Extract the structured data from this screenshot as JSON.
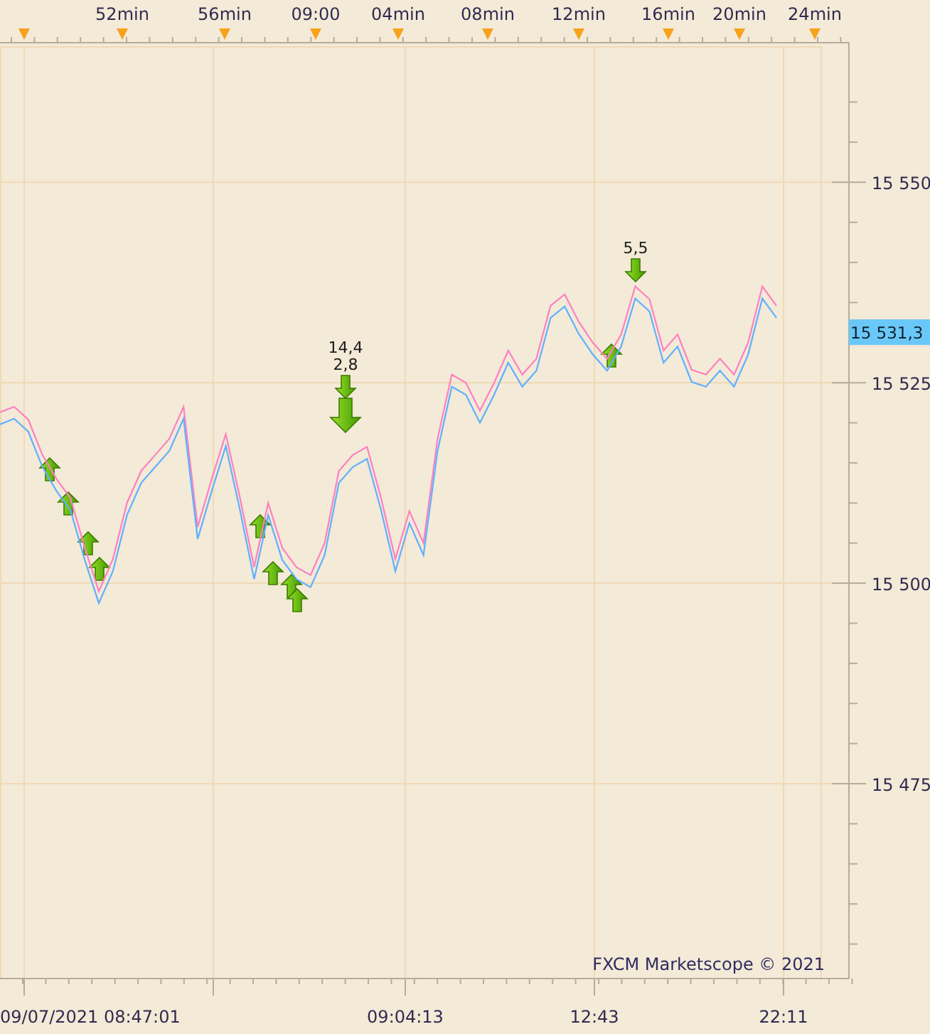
{
  "chart": {
    "footer": "FXCM Marketscope © 2021",
    "top_axis": [
      {
        "label": "52min"
      },
      {
        "label": "56min"
      },
      {
        "label": "09:00"
      },
      {
        "label": "04min"
      },
      {
        "label": "08min"
      },
      {
        "label": "12min"
      },
      {
        "label": "16min"
      },
      {
        "label": "20min"
      },
      {
        "label": "24min"
      }
    ],
    "time_axis": [
      {
        "label": "09/07/2021 08:47:01"
      },
      {
        "label": "09:04:13"
      },
      {
        "label": "12:43"
      },
      {
        "label": "22:11"
      }
    ],
    "last_price": "15 531,3",
    "signals": [
      {
        "kind": "buy"
      },
      {
        "kind": "buy"
      },
      {
        "kind": "buy"
      },
      {
        "kind": "buy"
      },
      {
        "kind": "buy"
      },
      {
        "kind": "buy"
      },
      {
        "kind": "buy"
      },
      {
        "kind": "buy"
      },
      {
        "kind": "buy"
      },
      {
        "kind": "sell"
      },
      {
        "kind": "sell_big",
        "labels": [
          "14,4",
          "2,8"
        ]
      },
      {
        "kind": "sell",
        "labels": [
          "5,5"
        ]
      }
    ],
    "chart_data": {
      "type": "line",
      "grid": true,
      "ylim": [
        15450.7,
        15567.4
      ],
      "yticks": [
        {
          "value": 15475,
          "label": "15 475"
        },
        {
          "value": 15500,
          "label": "15 500"
        },
        {
          "value": 15525,
          "label": "15 525"
        },
        {
          "value": 15550,
          "label": "15 550"
        }
      ],
      "series": [
        {
          "color": "#ff80c0",
          "values": [
            15521.3,
            15522,
            15520.4,
            15516,
            15513,
            15510.6,
            15504.4,
            15499,
            15503,
            15510,
            15514,
            15516,
            15518,
            15522,
            15507,
            15513,
            15518.6,
            15510.6,
            15502,
            15510,
            15504.4,
            15502,
            15501,
            15505,
            15514,
            15516,
            15517,
            15510.6,
            15503,
            15509,
            15505,
            15518,
            15526,
            15525,
            15521.5,
            15525,
            15529,
            15526,
            15528,
            15534.6,
            15536,
            15532.6,
            15530,
            15528,
            15531,
            15537,
            15535.4,
            15529,
            15531,
            15526.6,
            15526,
            15528,
            15526,
            15530,
            15537,
            15534.6
          ]
        },
        {
          "color": "#60b0ff",
          "values": [
            15519.8,
            15520.5,
            15518.9,
            15514.5,
            15511.5,
            15509.1,
            15502.9,
            15497.5,
            15501.5,
            15508.5,
            15512.5,
            15514.5,
            15516.5,
            15520.5,
            15505.5,
            15511.5,
            15517.1,
            15509.1,
            15500.5,
            15508.5,
            15502.9,
            15500.5,
            15499.5,
            15503.5,
            15512.5,
            15514.5,
            15515.5,
            15509.1,
            15501.5,
            15507.5,
            15503.5,
            15516.5,
            15524.5,
            15523.5,
            15520,
            15523.5,
            15527.5,
            15524.5,
            15526.5,
            15533.1,
            15534.5,
            15531.1,
            15528.5,
            15526.5,
            15529.5,
            15535.5,
            15533.9,
            15527.5,
            15529.5,
            15525.1,
            15524.5,
            15526.5,
            15524.5,
            15528.5,
            15535.5,
            15533.1
          ]
        }
      ]
    }
  }
}
